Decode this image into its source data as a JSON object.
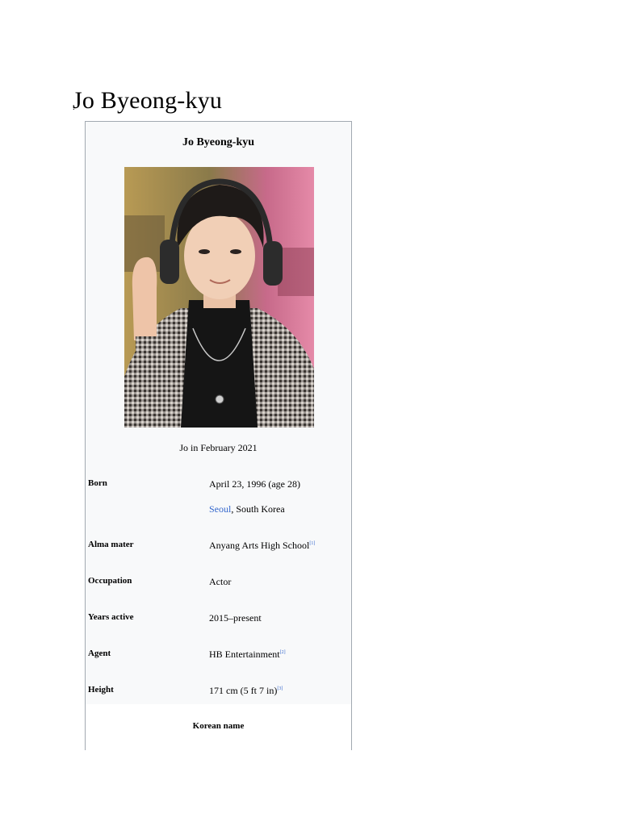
{
  "page": {
    "title": "Jo Byeong-kyu",
    "dot": "."
  },
  "infobox": {
    "title": "Jo Byeong-kyu",
    "caption": "Jo in February 2021",
    "rows": {
      "born": {
        "label": "Born",
        "date": "April 23, 1996 (age 28)",
        "place_link": "Seoul",
        "place_rest": ", South Korea"
      },
      "alma": {
        "label": "Alma mater",
        "value": "Anyang Arts High School",
        "ref": "[1]"
      },
      "occupation": {
        "label": "Occupation",
        "value": "Actor"
      },
      "years": {
        "label": "Years active",
        "value": "2015–present"
      },
      "agent": {
        "label": "Agent",
        "value": "HB Entertainment",
        "ref": "[2]"
      },
      "height": {
        "label": "Height",
        "value": "171 cm (5 ft 7 in)",
        "ref": "[3]"
      }
    },
    "korean_name": "Korean name"
  },
  "colors": {
    "link": "#3366cc",
    "infobox_bg": "#f8f9fa",
    "border": "#a2a9b1"
  }
}
